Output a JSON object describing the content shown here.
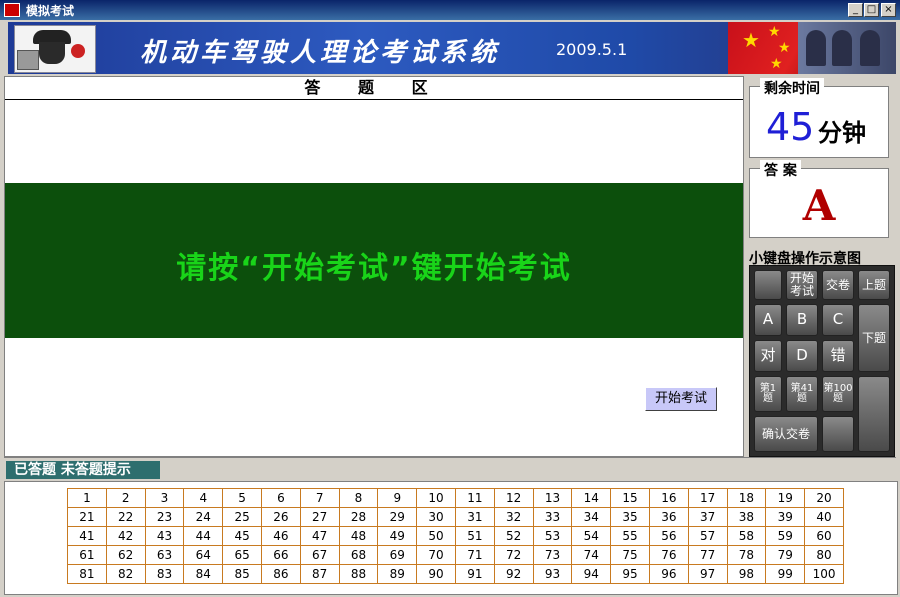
{
  "window": {
    "title": "模拟考试",
    "minimize": "_",
    "maximize": "□",
    "close": "×"
  },
  "banner": {
    "title": "机动车驾驶人理论考试系统",
    "date": "2009.5.1"
  },
  "answer_area": {
    "header": "答 题 区",
    "prompt": "请按“开始考试”键开始考试",
    "start_button": "开始考试"
  },
  "time_box": {
    "label": "剩余时间",
    "value": "45",
    "unit": "分钟"
  },
  "answer_box": {
    "label": "答 案",
    "value": "A"
  },
  "keyboard": {
    "title": "小键盘操作示意图",
    "keys": {
      "blank1": "",
      "start_exam": "开始考试",
      "submit": "交卷",
      "prev": "上题",
      "a": "A",
      "b": "B",
      "c": "C",
      "next": "下题",
      "right": "对",
      "d": "D",
      "wrong": "错",
      "q1": "第1题",
      "q41": "第41题",
      "q100": "第100题",
      "confirm": "确认交卷"
    }
  },
  "status_bar": {
    "answered_hint": "已答题 未答题提示"
  },
  "question_grid": [
    [
      "1",
      "2",
      "3",
      "4",
      "5",
      "6",
      "7",
      "8",
      "9",
      "10",
      "11",
      "12",
      "13",
      "14",
      "15",
      "16",
      "17",
      "18",
      "19",
      "20"
    ],
    [
      "21",
      "22",
      "23",
      "24",
      "25",
      "26",
      "27",
      "28",
      "29",
      "30",
      "31",
      "32",
      "33",
      "34",
      "35",
      "36",
      "37",
      "38",
      "39",
      "40"
    ],
    [
      "41",
      "42",
      "43",
      "44",
      "45",
      "46",
      "47",
      "48",
      "49",
      "50",
      "51",
      "52",
      "53",
      "54",
      "55",
      "56",
      "57",
      "58",
      "59",
      "60"
    ],
    [
      "61",
      "62",
      "63",
      "64",
      "65",
      "66",
      "67",
      "68",
      "69",
      "70",
      "71",
      "72",
      "73",
      "74",
      "75",
      "76",
      "77",
      "78",
      "79",
      "80"
    ],
    [
      "81",
      "82",
      "83",
      "84",
      "85",
      "86",
      "87",
      "88",
      "89",
      "90",
      "91",
      "92",
      "93",
      "94",
      "95",
      "96",
      "97",
      "98",
      "99",
      "100"
    ]
  ],
  "colors": {
    "prompt_green": "#19d419",
    "panel_green": "#0c4f0c",
    "time_blue": "#1f1fd6",
    "answer_red": "#b00000"
  }
}
